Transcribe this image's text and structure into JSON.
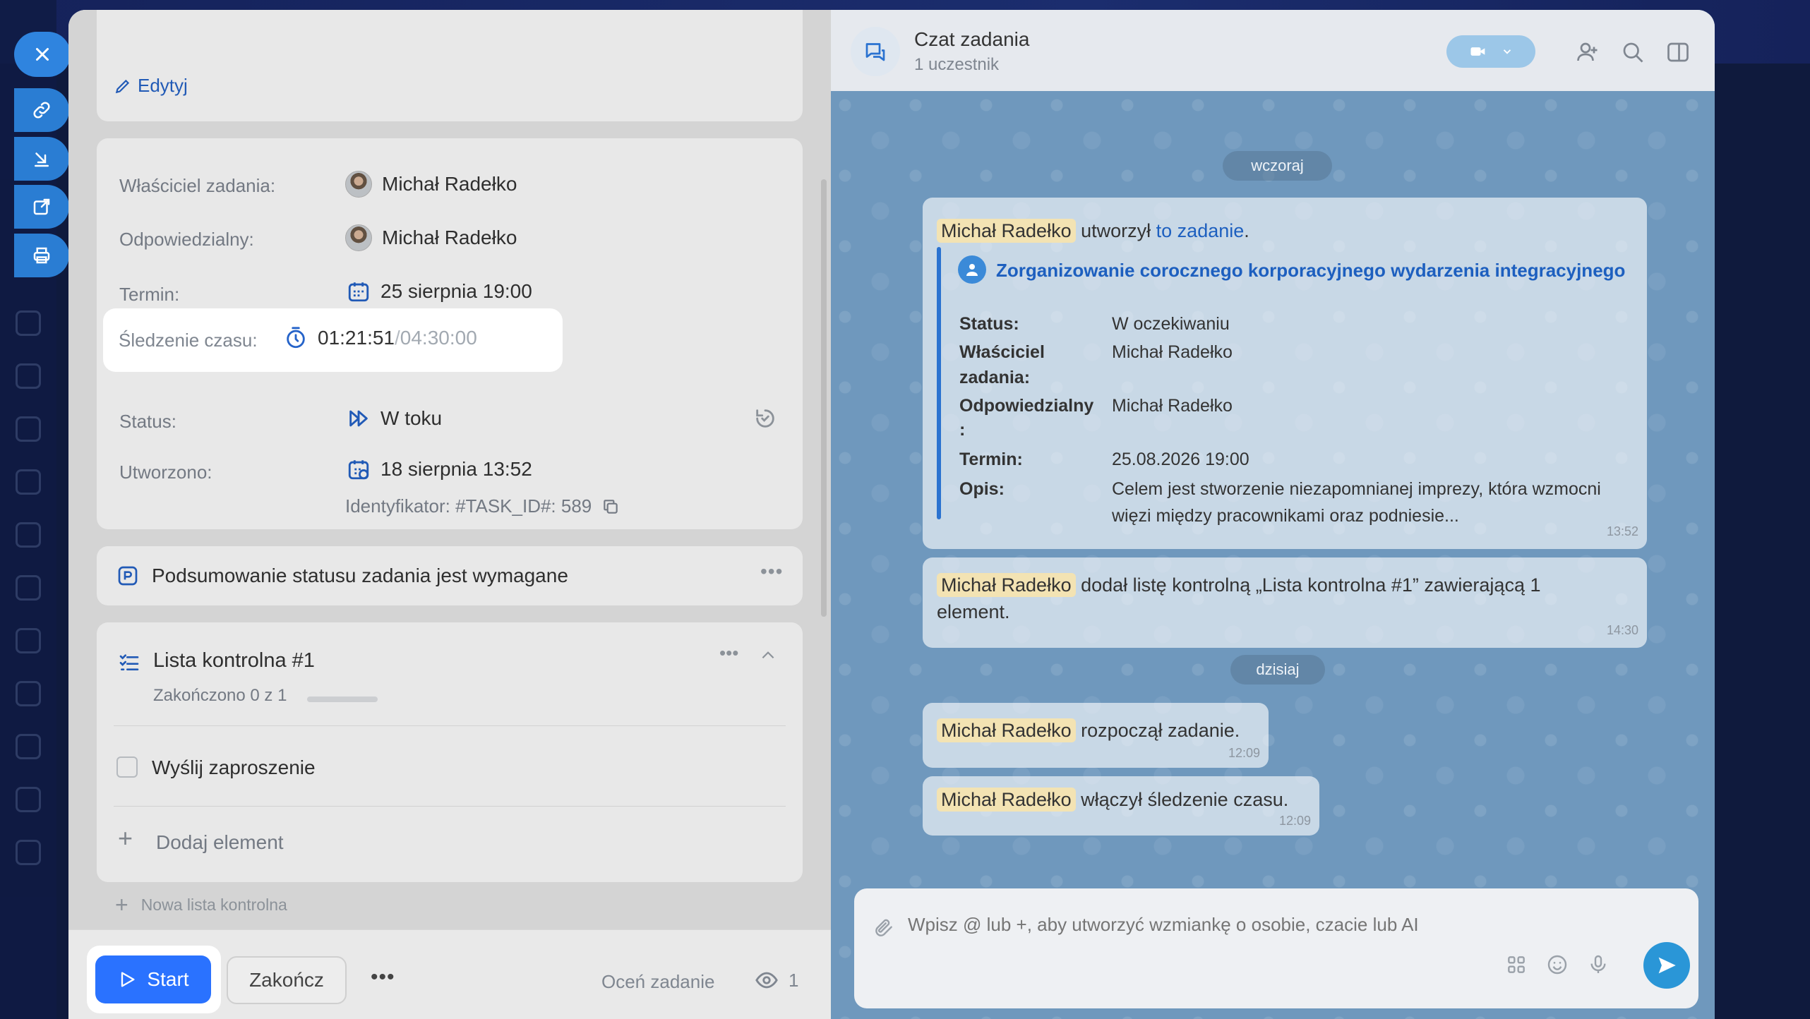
{
  "left": {
    "edit_label": "Edytyj",
    "fields": {
      "owner_label": "Właściciel zadania:",
      "owner_value": "Michał Radełko",
      "responsible_label": "Odpowiedzialny:",
      "responsible_value": "Michał Radełko",
      "deadline_label": "Termin:",
      "deadline_value": "25 sierpnia 19:00",
      "time_label": "Śledzenie czasu:",
      "time_elapsed": "01:21:51",
      "time_sep": "/",
      "time_total": "04:30:00",
      "status_label": "Status:",
      "status_value": "W toku",
      "created_label": "Utworzono:",
      "created_value": "18 sierpnia 13:52",
      "id_value": "Identyfikator: #TASK_ID#: 589"
    },
    "summary_label": "Podsumowanie statusu zadania jest wymagane",
    "checklist": {
      "title": "Lista kontrolna #1",
      "progress_text": "Zakończono 0 z 1",
      "progress": 0,
      "item": "Wyślij zaproszenie",
      "add_item": "Dodaj element",
      "new_list": "Nowa lista kontrolna"
    },
    "footer": {
      "start": "Start",
      "finish": "Zakończ",
      "rate": "Oceń zadanie",
      "views": "1"
    }
  },
  "chat": {
    "title": "Czat zadania",
    "subtitle": "1 uczestnik",
    "day_yesterday": "wczoraj",
    "day_today": "dzisiaj",
    "m1": {
      "name": "Michał Radełko",
      "text": "utworzył",
      "link": "to zadanie",
      "dot": ".",
      "task_title": "Zorganizowanie corocznego korporacyjnego wydarzenia integracyjnego",
      "status_k": "Status:",
      "status_v": "W oczekiwaniu",
      "owner_k1": "Właściciel",
      "owner_k2": "zadania:",
      "owner_v": "Michał Radełko",
      "resp_k1": "Odpowiedzialny",
      "resp_k2": ":",
      "resp_v": "Michał Radełko",
      "term_k": "Termin:",
      "term_v": "25.08.2026 19:00",
      "desc_k": "Opis:",
      "desc_v1": "Celem jest stworzenie niezapomnianej imprezy, która wzmocni",
      "desc_v2": "więzi między pracownikami oraz podniesie...",
      "time": "13:52"
    },
    "m2": {
      "name": "Michał Radełko",
      "text1": "dodał listę kontrolną „Lista kontrolna #1” zawierającą 1",
      "text2": "element.",
      "time": "14:30"
    },
    "m3": {
      "name": "Michał Radełko",
      "text": "rozpoczął zadanie.",
      "time": "12:09"
    },
    "m4": {
      "name": "Michał Radełko",
      "text": "włączył śledzenie czasu.",
      "time": "12:09"
    },
    "input_placeholder": "Wpisz @ lub +, aby utworzyć wzmiankę o osobie, czacie lub AI"
  },
  "colors": {
    "accent": "#2a72ff",
    "chat_bg": "#6f98bd",
    "link": "#1d5fbf"
  }
}
